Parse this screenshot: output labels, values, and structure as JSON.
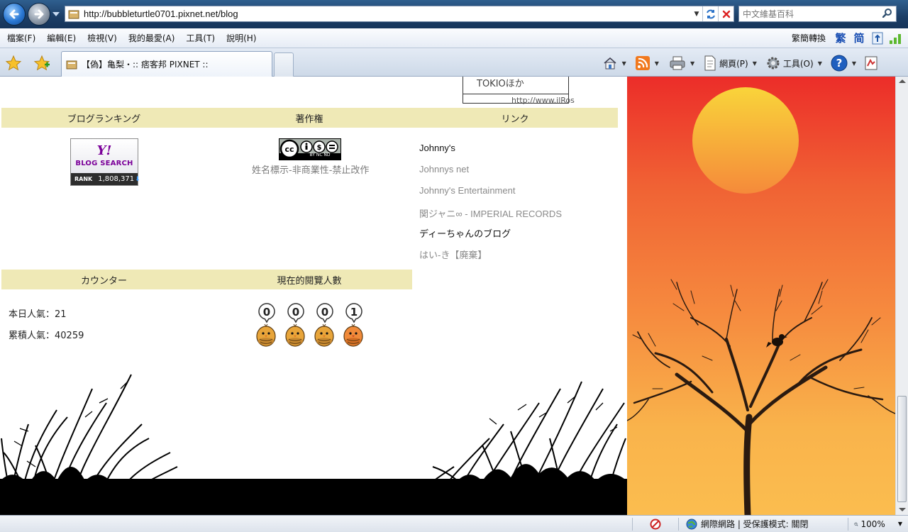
{
  "browser": {
    "url": "http://bubbleturtle0701.pixnet.net/blog",
    "search_placeholder": "中文維基百科",
    "menu": [
      "檔案(F)",
      "編輯(E)",
      "檢視(V)",
      "我的最愛(A)",
      "工具(T)",
      "說明(H)"
    ],
    "translate_label": "繁簡轉換",
    "trad_char": "繁",
    "simp_char": "简",
    "tab_title": "【偽】亀梨・:: 痞客邦 PIXNET ::",
    "page_label": "網頁(P)",
    "tools_label": "工具(O)",
    "status_zone": "網際網路 | 受保護模式: 關閉",
    "zoom": "100%"
  },
  "page": {
    "top_widget_text": "TOKIOほか",
    "top_widget_cut": "http://www.ilRos",
    "ranking": {
      "header": "ブログランキング",
      "yahoo_y": "Y!",
      "yahoo_label": "BLOG SEARCH",
      "rank_label": "RANK",
      "rank_value": "1,808,371"
    },
    "copyright": {
      "header": "著作権",
      "badge_text": "BY  NC  ND",
      "description": "姓名標示-非商業性-禁止改作"
    },
    "links": {
      "header": "リンク",
      "items": [
        {
          "label": "Johnny's",
          "style": "dark"
        },
        {
          "label": "Johnnys net",
          "style": "grey"
        },
        {
          "label": "Johnny's Entertainment",
          "style": "grey"
        },
        {
          "label": "関ジャニ∞ - IMPERIAL RECORDS",
          "style": "grey"
        },
        {
          "label": "ディーちゃんのブログ",
          "style": "dark"
        },
        {
          "label": "はい-き【廃棄】",
          "style": "grey"
        }
      ]
    },
    "counter": {
      "header": "カウンター",
      "today": "本日人氣：21",
      "total": "累積人氣：40259"
    },
    "viewers": {
      "header": "現在的閱覽人數",
      "digits": [
        "0",
        "0",
        "0",
        "1"
      ]
    }
  },
  "colors": {
    "section_header_bg": "#efe9b6",
    "link_grey": "#8a8a8a",
    "sunset_top": "#ec2d29",
    "sunset_bottom": "#fbbd4f"
  }
}
